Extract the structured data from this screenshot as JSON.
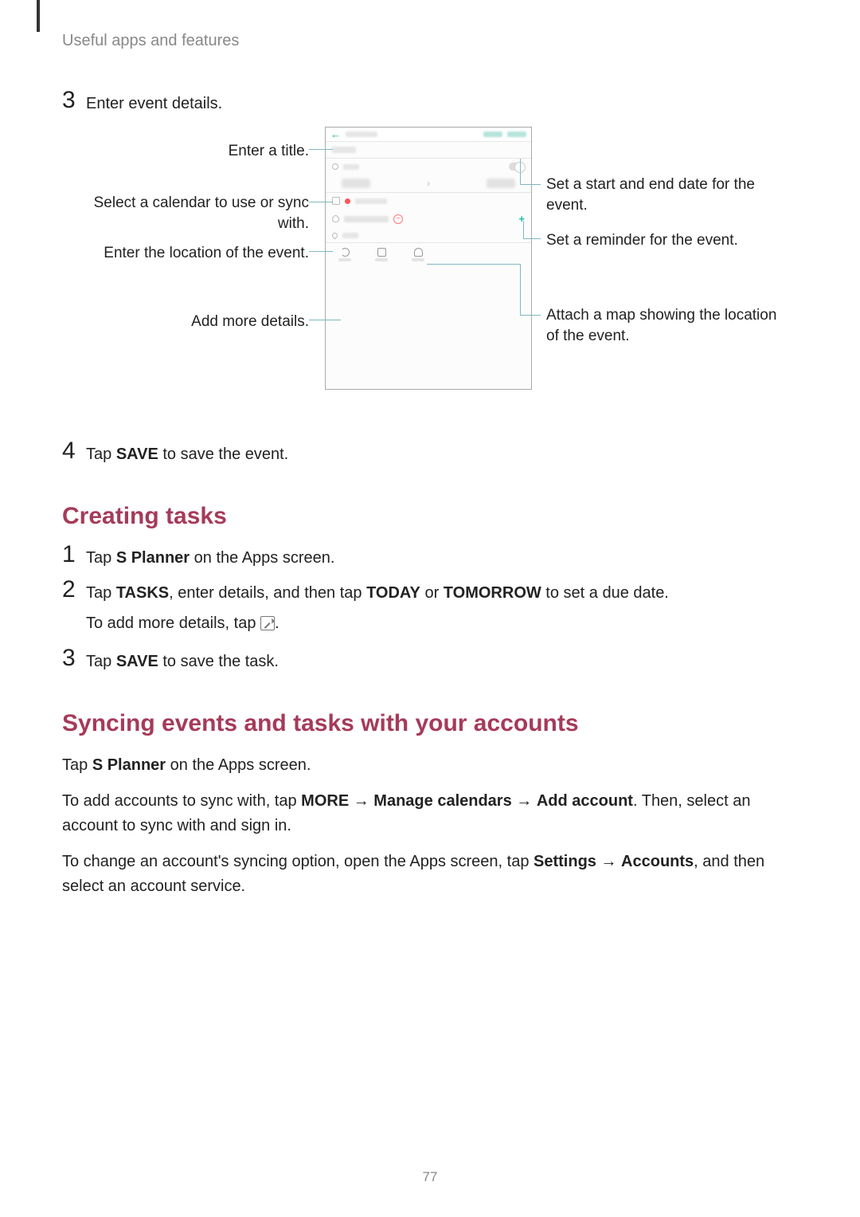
{
  "chapter": "Useful apps and features",
  "page_number": "77",
  "step3": {
    "num": "3",
    "text": "Enter event details."
  },
  "callouts": {
    "title": "Enter a title.",
    "calendar": "Select a calendar to use or sync with.",
    "location": "Enter the location of the event.",
    "details": "Add more details.",
    "dates": "Set a start and end date for the event.",
    "reminder": "Set a reminder for the event.",
    "map": "Attach a map showing the location of the event."
  },
  "step4": {
    "num": "4",
    "pre": "Tap ",
    "bold": "SAVE",
    "post": " to save the event."
  },
  "heading_tasks": "Creating tasks",
  "tasks": {
    "s1": {
      "num": "1",
      "pre": "Tap ",
      "b1": "S Planner",
      "post": " on the Apps screen."
    },
    "s2": {
      "num": "2",
      "pre": "Tap ",
      "b1": "TASKS",
      "mid1": ", enter details, and then tap ",
      "b2": "TODAY",
      "mid2": " or ",
      "b3": "TOMORROW",
      "post": " to set a due date.",
      "sub_pre": "To add more details, tap ",
      "sub_post": "."
    },
    "s3": {
      "num": "3",
      "pre": "Tap ",
      "b1": "SAVE",
      "post": " to save the task."
    }
  },
  "heading_sync": "Syncing events and tasks with your accounts",
  "sync": {
    "p1_pre": "Tap ",
    "p1_b": "S Planner",
    "p1_post": " on the Apps screen.",
    "p2_pre": "To add accounts to sync with, tap ",
    "p2_b1": "MORE",
    "arrow": " → ",
    "p2_b2": "Manage calendars",
    "p2_b3": "Add account",
    "p2_post": ". Then, select an account to sync with and sign in.",
    "p3_pre": "To change an account's syncing option, open the Apps screen, tap ",
    "p3_b1": "Settings",
    "p3_b2": "Accounts",
    "p3_post": ", and then select an account service."
  }
}
